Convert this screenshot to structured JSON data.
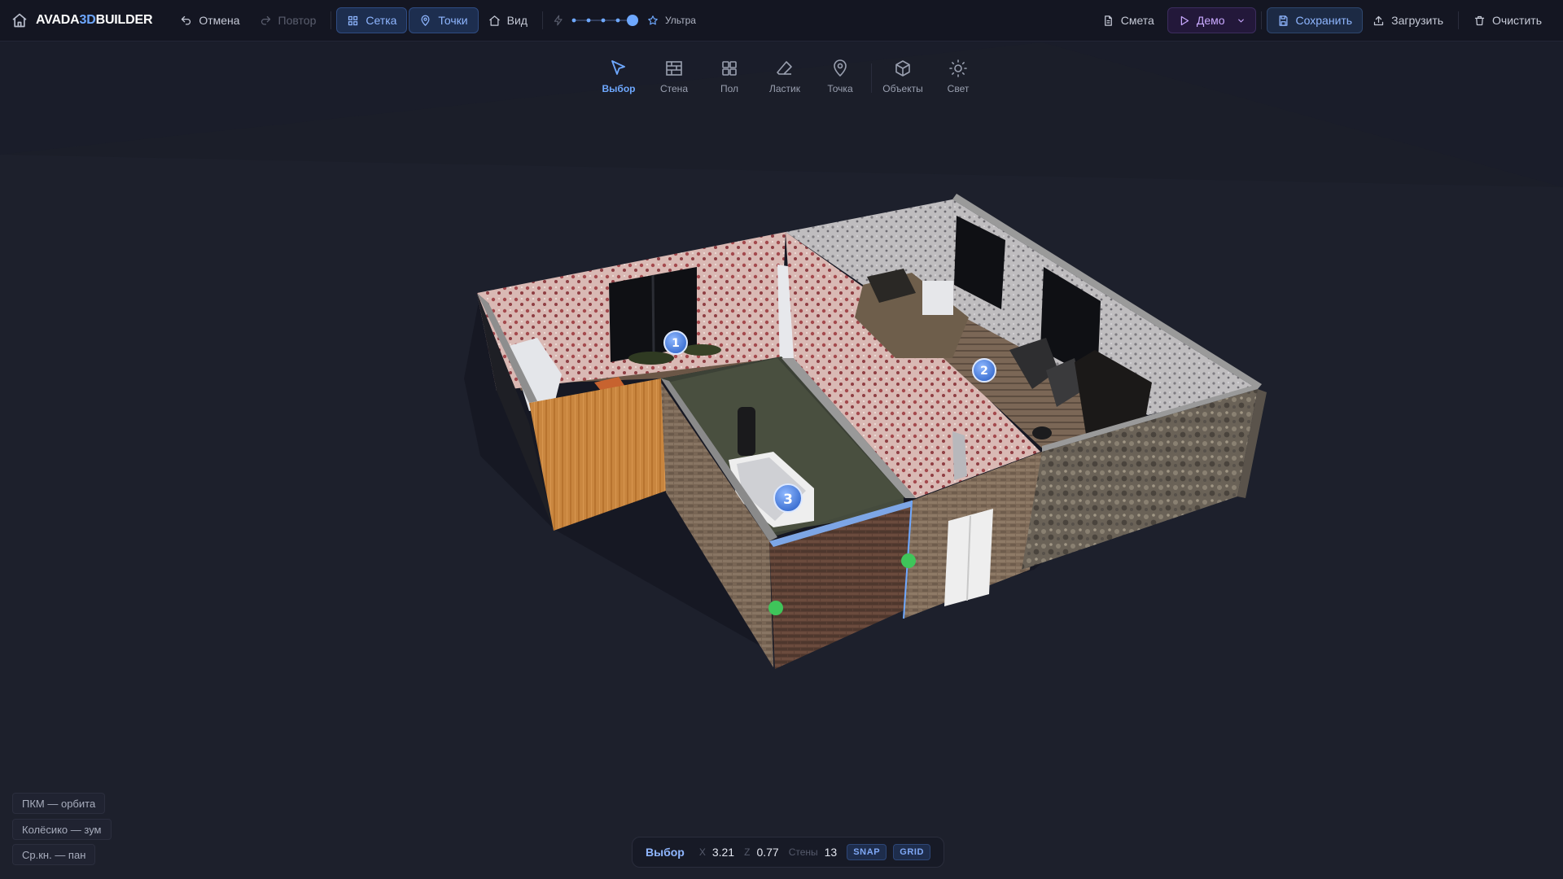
{
  "app": {
    "logo_part1": "AVADA",
    "logo_part2": "3D",
    "logo_part3": "BUILDER"
  },
  "topbar": {
    "undo": "Отмена",
    "redo": "Повтор",
    "grid": "Сетка",
    "points": "Точки",
    "view": "Вид",
    "quality_label": "Ультра",
    "quality_level": 5,
    "quality_max": 5,
    "estimate": "Смета",
    "demo": "Демо",
    "save": "Сохранить",
    "load": "Загрузить",
    "clear": "Очистить"
  },
  "tools": [
    {
      "label": "Выбор",
      "icon": "cursor-icon",
      "active": true
    },
    {
      "label": "Стена",
      "icon": "wall-icon",
      "active": false
    },
    {
      "label": "Пол",
      "icon": "floor-icon",
      "active": false
    },
    {
      "label": "Ластик",
      "icon": "eraser-icon",
      "active": false
    },
    {
      "label": "Точка",
      "icon": "map-pin-icon",
      "active": false
    },
    {
      "label": "Объекты",
      "icon": "cube-icon",
      "active": false
    },
    {
      "label": "Свет",
      "icon": "sun-icon",
      "active": false
    }
  ],
  "rooms": [
    {
      "number": "1"
    },
    {
      "number": "2"
    },
    {
      "number": "3"
    }
  ],
  "hints": [
    "ПКМ — орбита",
    "Колёсико — зум",
    "Ср.кн. — пан"
  ],
  "status": {
    "mode": "Выбор",
    "x_label": "X",
    "x_value": "3.21",
    "z_label": "Z",
    "z_value": "0.77",
    "walls_label": "Стены",
    "walls_value": "13",
    "snap": "SNAP",
    "grid": "GRID"
  },
  "colors": {
    "accent": "#6ea8ff",
    "handle": "#3fc55a",
    "background": "#1a1d2a"
  }
}
